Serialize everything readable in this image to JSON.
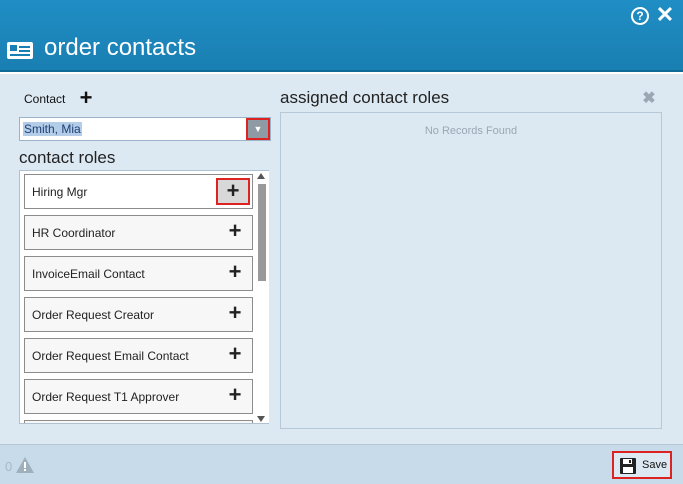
{
  "window": {
    "title": "order contacts",
    "help_icon": "help-icon",
    "close_icon": "close-icon",
    "help_glyph": "?",
    "close_glyph": "✕"
  },
  "contact": {
    "label": "Contact",
    "add_glyph": "+",
    "selected_value": "Smith, Mia",
    "dropdown_glyph": "▼"
  },
  "contact_roles": {
    "heading": "contact roles",
    "add_glyph": "+",
    "items": [
      {
        "label": "Hiring Mgr"
      },
      {
        "label": "HR Coordinator"
      },
      {
        "label": "InvoiceEmail Contact"
      },
      {
        "label": "Order Request Creator"
      },
      {
        "label": "Order Request Email Contact"
      },
      {
        "label": "Order Request T1 Approver"
      },
      {
        "label": ""
      }
    ]
  },
  "assigned_roles": {
    "heading": "assigned contact roles",
    "clear_glyph": "✖",
    "empty_text": "No Records Found"
  },
  "footer": {
    "warning_count": "0",
    "save_label": "Save"
  },
  "colors": {
    "titlebar": "#1a7fb2",
    "body": "#dce9f3",
    "footer": "#c8dbea",
    "highlight_border": "#dd2222"
  }
}
